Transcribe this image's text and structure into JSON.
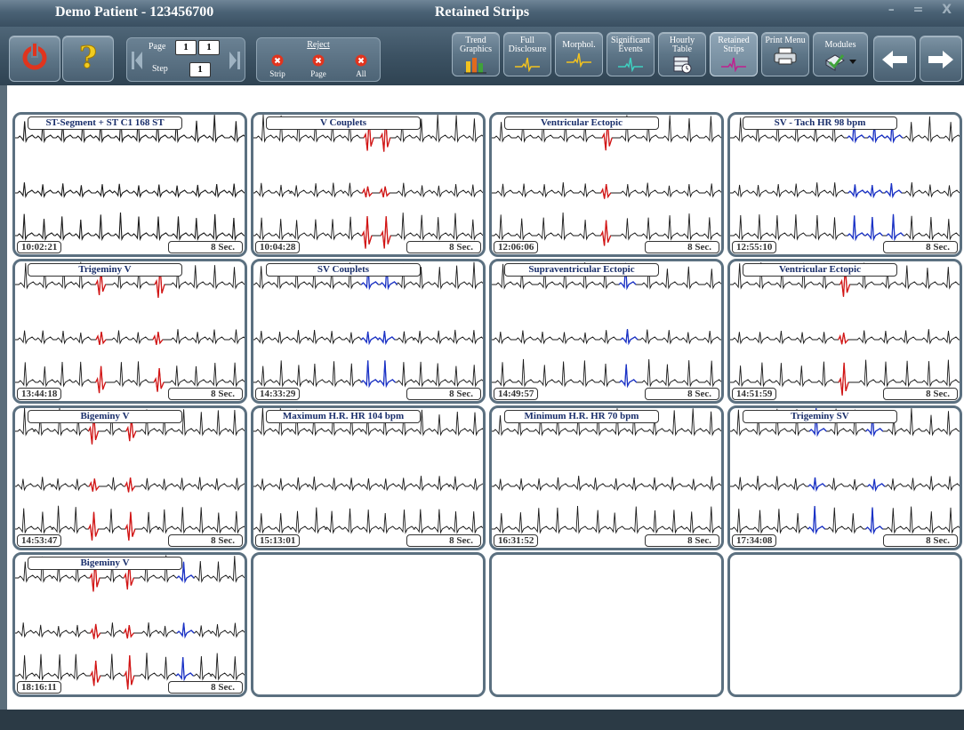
{
  "window": {
    "patient": "Demo Patient - 123456700",
    "title": "Retained Strips",
    "controls": "– = X"
  },
  "toolbar": {
    "page_label": "Page",
    "page_current": "1",
    "page_total": "1",
    "step_label": "Step",
    "step_value": "1",
    "reject_label": "Reject",
    "reject_strip": "Strip",
    "reject_page": "Page",
    "reject_all": "All",
    "buttons": [
      {
        "label": "Trend Graphics",
        "icon": "bar-chart-icon"
      },
      {
        "label": "Full Disclosure",
        "icon": "ecg-wave-icon"
      },
      {
        "label": "Morphol.",
        "icon": "ecg-wave-icon"
      },
      {
        "label": "Significant Events",
        "icon": "ecg-wave-icon"
      },
      {
        "label": "Hourly Table",
        "icon": "table-clock-icon"
      },
      {
        "label": "Retained Strips",
        "icon": "ecg-wave-icon"
      },
      {
        "label": "Print Menu",
        "icon": "printer-icon"
      },
      {
        "label": "Modules",
        "icon": "modules-icon"
      }
    ]
  },
  "strips": [
    {
      "label": "ST-Segment + ST C1 168 ST",
      "time": "10:02:21",
      "duration": "8 Sec."
    },
    {
      "label": "V Couplets",
      "time": "10:04:28",
      "duration": "8 Sec."
    },
    {
      "label": "Ventricular Ectopic",
      "time": "12:06:06",
      "duration": "8 Sec."
    },
    {
      "label": "SV - Tach HR 98 bpm",
      "time": "12:55:10",
      "duration": "8 Sec."
    },
    {
      "label": "Trigeminy V",
      "time": "13:44:18",
      "duration": "8 Sec."
    },
    {
      "label": "SV Couplets",
      "time": "14:33:29",
      "duration": "8 Sec."
    },
    {
      "label": "Supraventricular Ectopic",
      "time": "14:49:57",
      "duration": "8 Sec."
    },
    {
      "label": "Ventricular Ectopic",
      "time": "14:51:59",
      "duration": "8 Sec."
    },
    {
      "label": "Bigeminy V",
      "time": "14:53:47",
      "duration": "8 Sec."
    },
    {
      "label": "Maximum H.R.    HR 104 bpm",
      "time": "15:13:01",
      "duration": "8 Sec."
    },
    {
      "label": "Minimum H.R.    HR 70 bpm",
      "time": "16:31:52",
      "duration": "8 Sec."
    },
    {
      "label": "Trigeminy SV",
      "time": "17:34:08",
      "duration": "8 Sec."
    },
    {
      "label": "Bigeminy V",
      "time": "18:16:11",
      "duration": "8 Sec."
    }
  ],
  "colors": {
    "trace": "#1a1a1a",
    "ventricular": "#d41414",
    "supraventricular": "#1a32c8",
    "frame": "#5b7080"
  }
}
